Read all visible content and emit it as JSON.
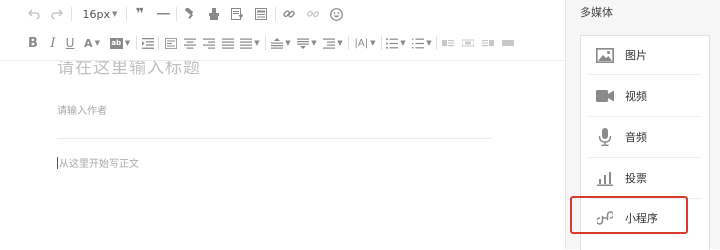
{
  "toolbar": {
    "font_size": "16px",
    "buttons": [
      "undo-icon",
      "redo-icon",
      "font-size-select",
      "blockquote-icon",
      "horizontal-rule-icon",
      "format-painter-icon",
      "clear-format-icon",
      "insert-template-icon",
      "insert-table-icon",
      "link-icon",
      "unlink-icon",
      "emoji-icon",
      "bold-icon",
      "italic-icon",
      "underline-icon",
      "font-color-icon",
      "background-color-icon",
      "indent-icon",
      "align-left-icon",
      "align-center-icon",
      "align-right-icon",
      "justify-icon",
      "line-height-icon",
      "paragraph-spacing-before-icon",
      "paragraph-spacing-after-icon",
      "letter-spacing-icon",
      "unordered-list-icon",
      "ordered-list-icon",
      "image-layout-left-icon",
      "image-layout-center-icon",
      "image-layout-right-icon",
      "image-layout-full-icon"
    ]
  },
  "editor": {
    "title_placeholder": "请在这里输入标题",
    "author_placeholder": "请输入作者",
    "body_placeholder": "从这里开始写正文"
  },
  "sidebar": {
    "title": "多媒体",
    "items": [
      {
        "label": "图片",
        "icon": "image-icon"
      },
      {
        "label": "视频",
        "icon": "video-icon"
      },
      {
        "label": "音频",
        "icon": "microphone-icon"
      },
      {
        "label": "投票",
        "icon": "poll-chart-icon"
      },
      {
        "label": "小程序",
        "icon": "mini-program-icon"
      }
    ],
    "highlighted_item": "小程序",
    "highlight_color": "#d93a2b"
  }
}
